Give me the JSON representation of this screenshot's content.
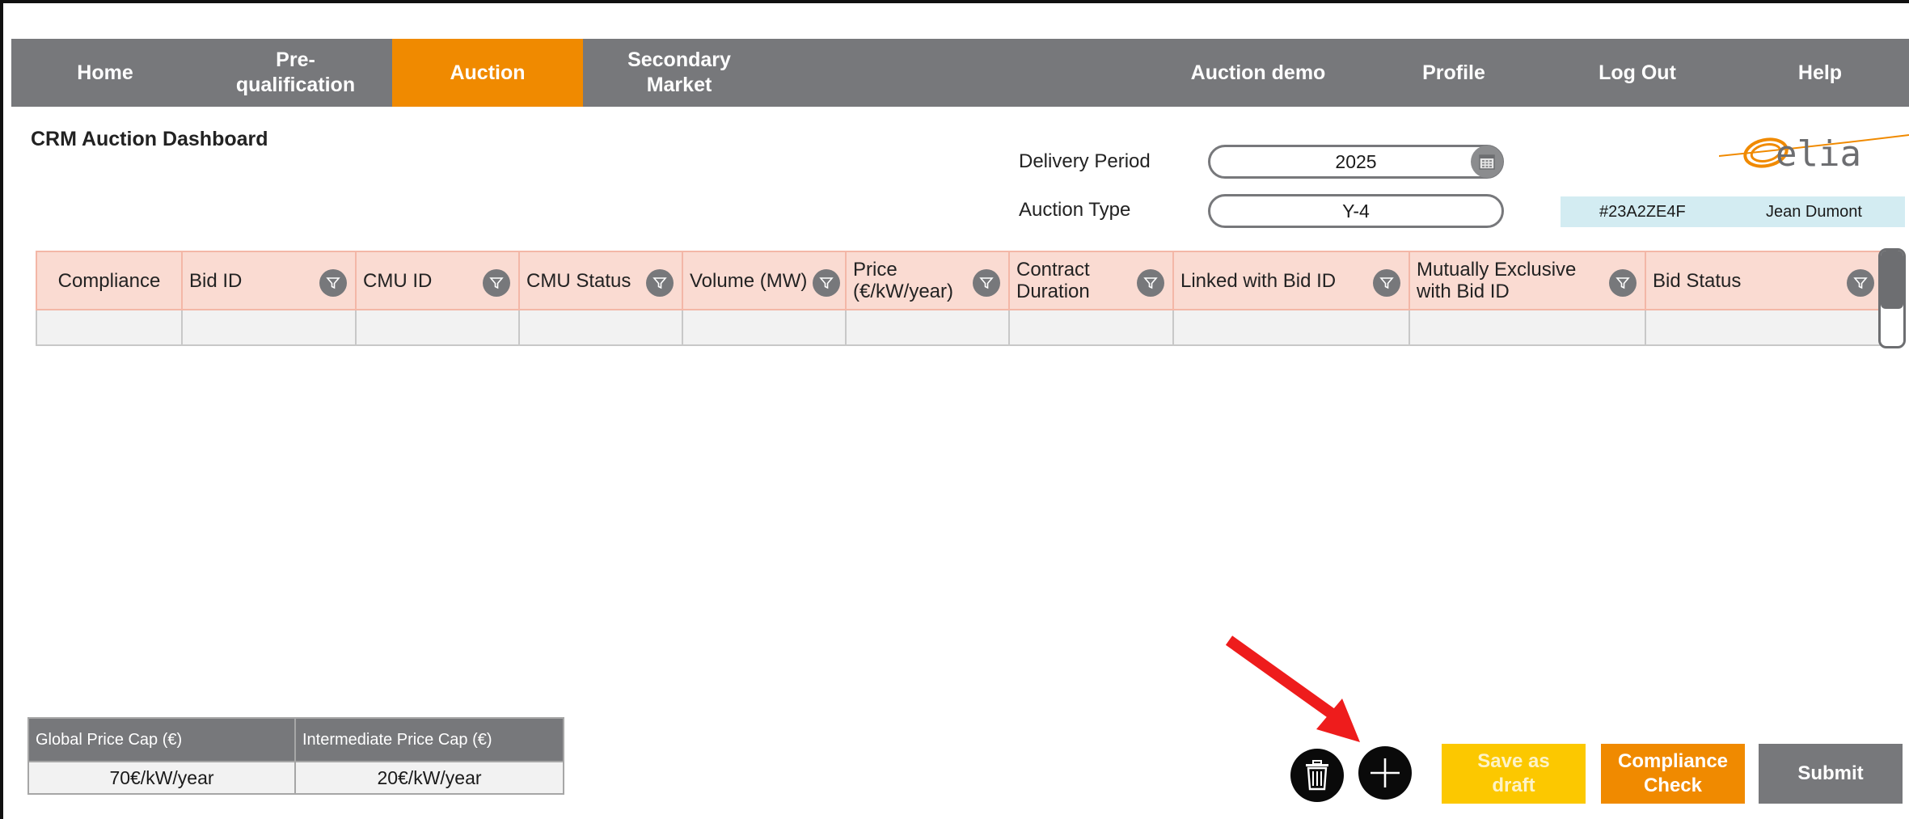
{
  "nav": {
    "home": "Home",
    "prequalification": "Pre-\nqualification",
    "auction": "Auction",
    "secondary_market": "Secondary\nMarket",
    "auction_demo": "Auction demo",
    "profile": "Profile",
    "logout": "Log Out",
    "help": "Help",
    "active": "Auction"
  },
  "page_title": "CRM Auction Dashboard",
  "filters": {
    "delivery_period_label": "Delivery Period",
    "delivery_period_value": "2025",
    "auction_type_label": "Auction Type",
    "auction_type_value": "Y-4"
  },
  "logo_text": "elia",
  "user": {
    "id": "#23A2ZE4F",
    "name": "Jean Dumont"
  },
  "table": {
    "columns": [
      {
        "label": "Compliance",
        "filter": false
      },
      {
        "label": "Bid ID",
        "filter": true
      },
      {
        "label": "CMU ID",
        "filter": true
      },
      {
        "label": "CMU Status",
        "filter": true
      },
      {
        "label": "Volume (MW)",
        "filter": true
      },
      {
        "label": "Price\n(€/kW/year)",
        "filter": true
      },
      {
        "label": "Contract\nDuration",
        "filter": true
      },
      {
        "label": "Linked with Bid ID",
        "filter": true
      },
      {
        "label": "Mutually Exclusive\nwith Bid ID",
        "filter": true
      },
      {
        "label": "Bid Status",
        "filter": true
      }
    ]
  },
  "price_caps": {
    "global_label": "Global Price Cap (€)",
    "global_value": "70€/kW/year",
    "intermediate_label": "Intermediate Price Cap (€)",
    "intermediate_value": "20€/kW/year"
  },
  "actions": {
    "save_draft": "Save as\ndraft",
    "compliance_check": "Compliance\nCheck",
    "submit": "Submit"
  },
  "colors": {
    "nav_bg": "#77787b",
    "accent_orange": "#f08a00",
    "save_yellow": "#fcc800",
    "header_pink": "#fadbd2",
    "user_bar": "#d3ecf2",
    "arrow_red": "#ee1c1c"
  },
  "icons": {
    "calendar": "calendar-icon",
    "filter": "filter-icon",
    "trash": "trash-icon",
    "add": "plus-icon"
  }
}
